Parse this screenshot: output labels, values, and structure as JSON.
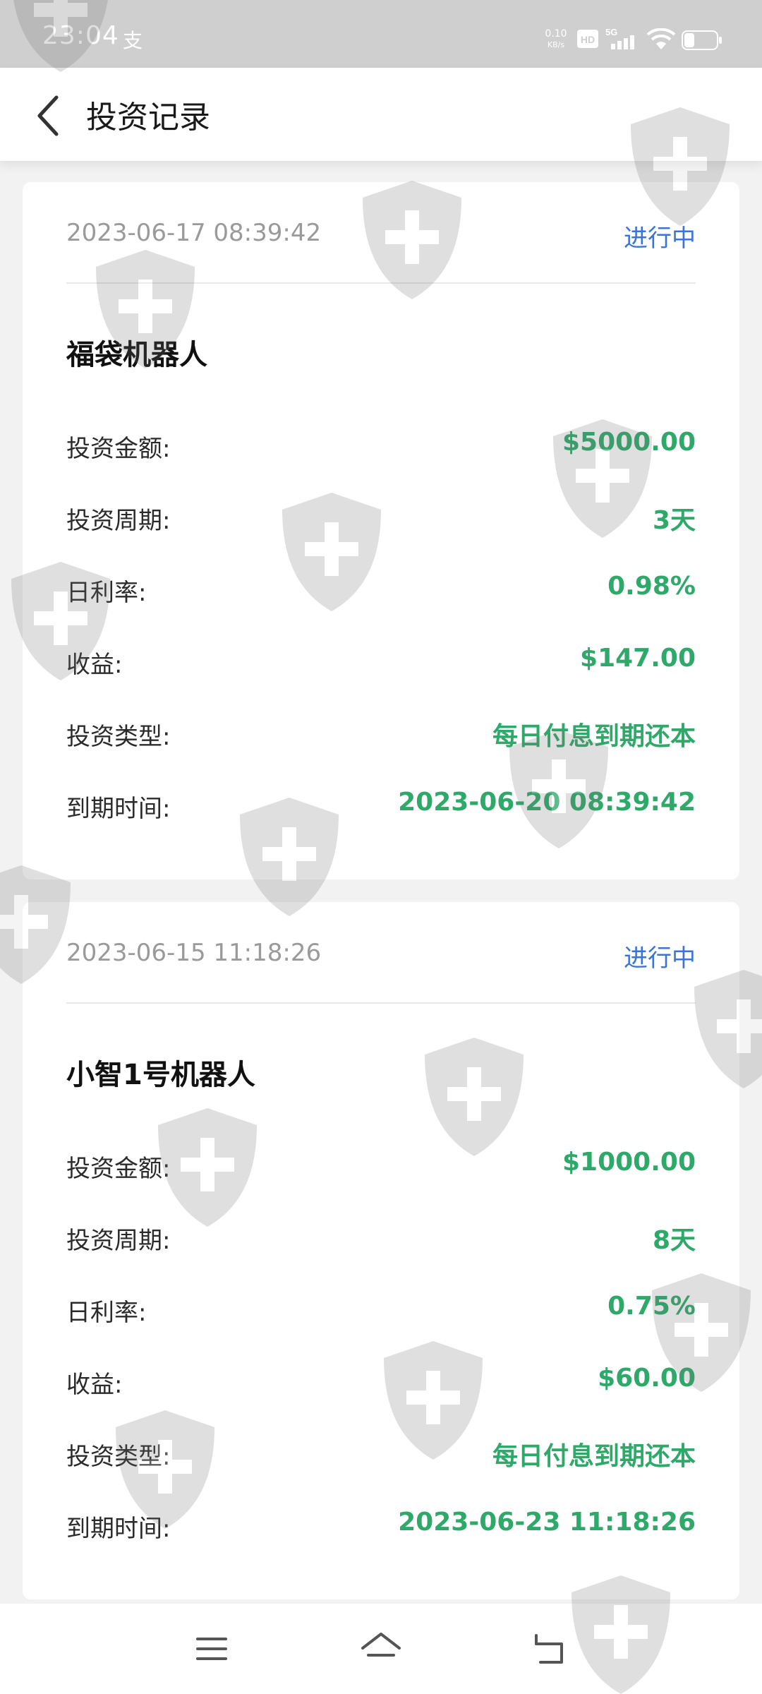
{
  "status_bar": {
    "time": "23:04",
    "pay_glyph": "支",
    "speed_value": "0.10",
    "speed_unit": "KB/s",
    "hd_label": "HD",
    "network_label": "5G"
  },
  "header": {
    "title": "投资记录",
    "back_icon": "chevron-left-icon"
  },
  "records": [
    {
      "date": "2023-06-17 08:39:42",
      "status": "进行中",
      "name": "福袋机器人",
      "rows": [
        {
          "label": "投资金额:",
          "value": "$5000.00"
        },
        {
          "label": "投资周期:",
          "value": "3天"
        },
        {
          "label": "日利率:",
          "value": "0.98%"
        },
        {
          "label": "收益:",
          "value": "$147.00"
        },
        {
          "label": "投资类型:",
          "value": "每日付息到期还本"
        },
        {
          "label": "到期时间:",
          "value": "2023-06-20 08:39:42"
        }
      ]
    },
    {
      "date": "2023-06-15 11:18:26",
      "status": "进行中",
      "name": "小智1号机器人",
      "rows": [
        {
          "label": "投资金额:",
          "value": "$1000.00"
        },
        {
          "label": "投资周期:",
          "value": "8天"
        },
        {
          "label": "日利率:",
          "value": "0.75%"
        },
        {
          "label": "收益:",
          "value": "$60.00"
        },
        {
          "label": "投资类型:",
          "value": "每日付息到期还本"
        },
        {
          "label": "到期时间:",
          "value": "2023-06-23 11:18:26"
        }
      ]
    }
  ],
  "bottom_nav": {
    "menu_icon": "menu-icon",
    "home_icon": "home-icon",
    "back_icon": "return-icon"
  },
  "colors": {
    "status_blue": "#3b74d6",
    "value_green": "#2fa96a",
    "date_gray": "#9a9a9a",
    "background": "#f2f2f2"
  }
}
